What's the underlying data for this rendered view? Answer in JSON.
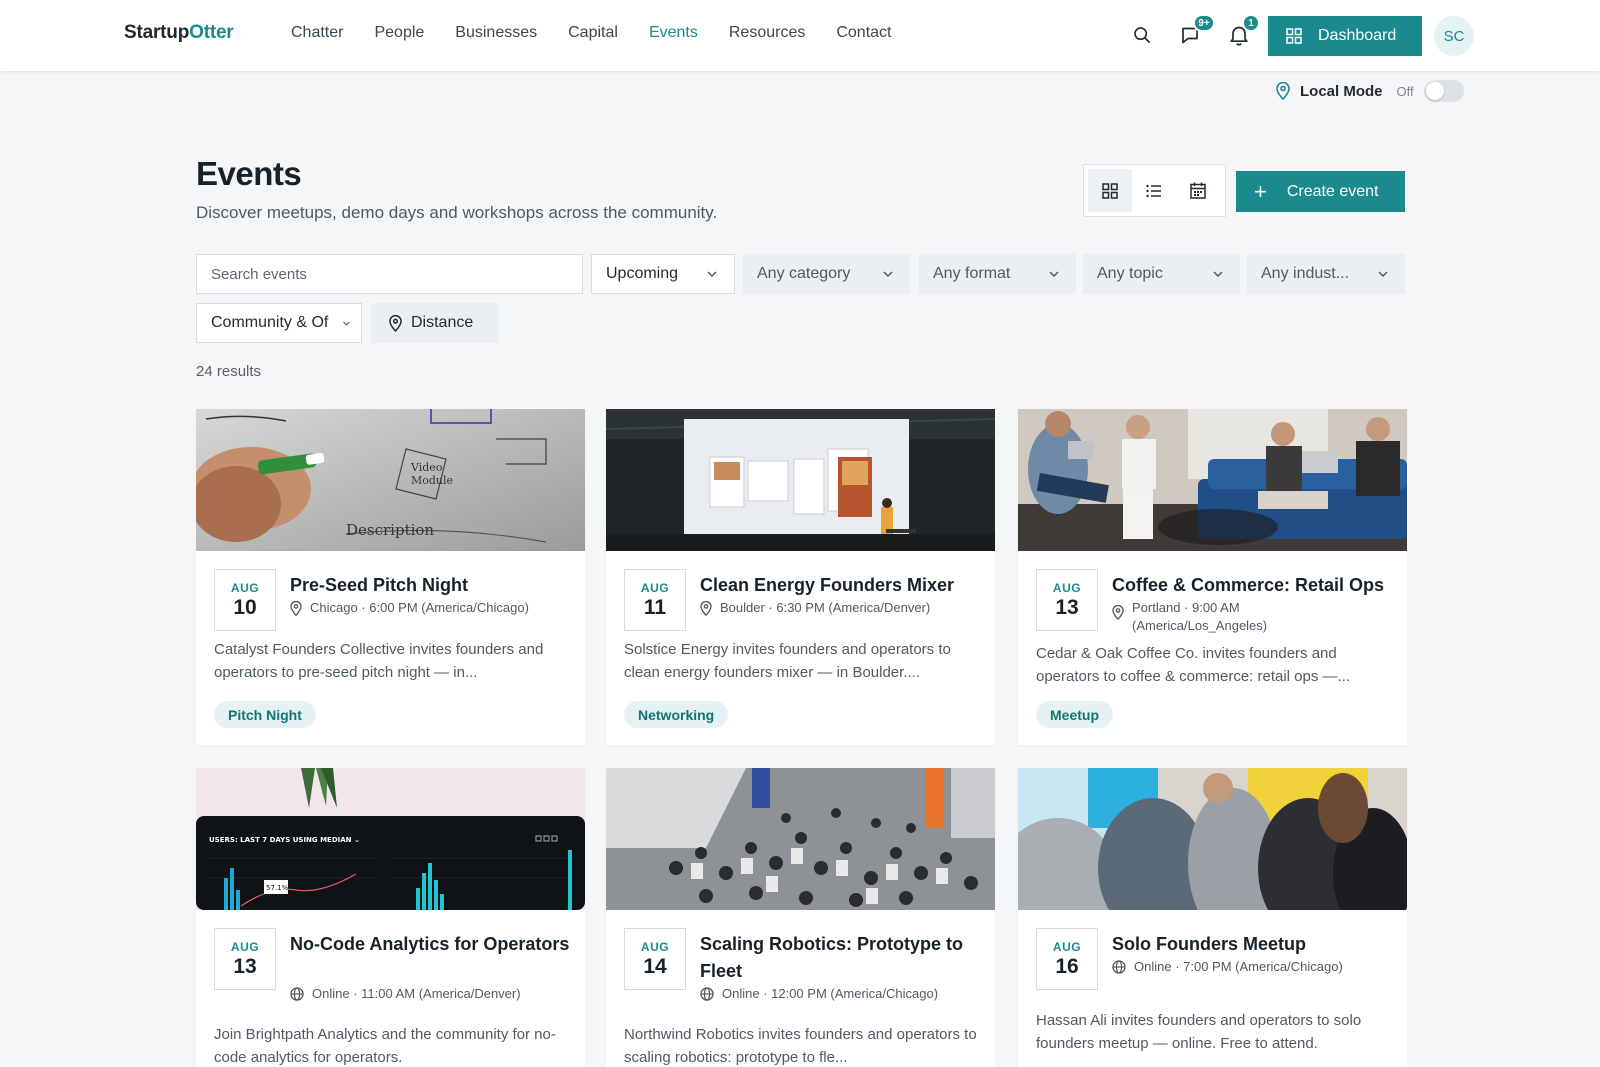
{
  "header": {
    "logo_part1": "Startup",
    "logo_part2": "Otter",
    "nav": [
      "Chatter",
      "People",
      "Businesses",
      "Capital",
      "Events",
      "Resources",
      "Contact"
    ],
    "active_nav": "Events",
    "messages_badge": "9+",
    "notifications_badge": "1",
    "dashboard_label": "Dashboard",
    "avatar_initials": "SC",
    "accent_color": "#1a8a8f"
  },
  "local_mode": {
    "label": "Local Mode",
    "state": "Off",
    "enabled": false
  },
  "page": {
    "title": "Events",
    "subtitle": "Discover meetups, demo days and workshops across the community.",
    "create_label": "Create event",
    "view_modes": [
      "grid-icon",
      "list-icon",
      "calendar-icon"
    ],
    "active_view": "grid-icon"
  },
  "filters": {
    "search_placeholder": "Search events",
    "when": "Upcoming",
    "category": "Any category",
    "format": "Any format",
    "topic": "Any topic",
    "industry": "Any indust...",
    "scope": "Community & Of",
    "distance_label": "Distance"
  },
  "results_text": "24 results",
  "events": [
    {
      "month": "AUG",
      "day": "10",
      "title": "Pre-Seed Pitch Night",
      "location_icon": "map-pin-icon",
      "meta": "Chicago · 6:00 PM (America/Chicago)",
      "description": "Catalyst Founders Collective invites founders and operators to pre-seed pitch night — in...",
      "tag": "Pitch Night"
    },
    {
      "month": "AUG",
      "day": "11",
      "title": "Clean Energy Founders Mixer",
      "location_icon": "map-pin-icon",
      "meta": "Boulder · 6:30 PM (America/Denver)",
      "description": "Solstice Energy invites founders and operators to clean energy founders mixer — in Boulder....",
      "tag": "Networking"
    },
    {
      "month": "AUG",
      "day": "13",
      "title": "Coffee & Commerce: Retail Ops",
      "location_icon": "map-pin-icon",
      "meta": "Portland · 9:00 AM (America/Los_Angeles)",
      "description": "Cedar & Oak Coffee Co. invites founders and operators to coffee & commerce: retail ops —...",
      "tag": "Meetup"
    },
    {
      "month": "AUG",
      "day": "13",
      "title": "No-Code Analytics for Operators",
      "location_icon": "globe-icon",
      "meta": "Online · 11:00 AM (America/Denver)",
      "description": "Join Brightpath Analytics and the community for no-code analytics for operators.",
      "tag": ""
    },
    {
      "month": "AUG",
      "day": "14",
      "title": "Scaling Robotics: Prototype to Fleet",
      "location_icon": "globe-icon",
      "meta": "Online · 12:00 PM (America/Chicago)",
      "description": "Northwind Robotics invites founders and operators to scaling robotics: prototype to fle...",
      "tag": ""
    },
    {
      "month": "AUG",
      "day": "16",
      "title": "Solo Founders Meetup",
      "location_icon": "globe-icon",
      "meta": "Online · 7:00 PM (America/Chicago)",
      "description": "Hassan Ali invites founders and operators to solo founders meetup — online. Free to attend.",
      "tag": ""
    }
  ]
}
